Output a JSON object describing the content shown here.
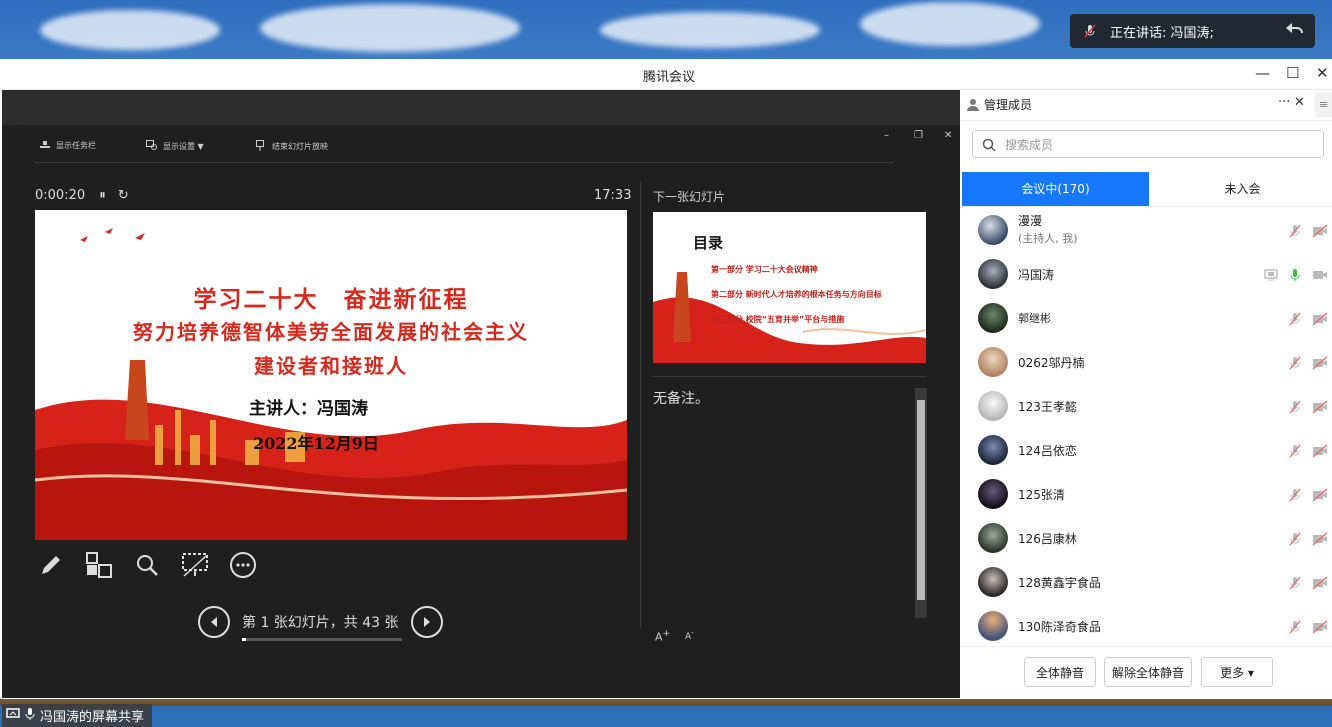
{
  "speaking": {
    "text": "正在讲话: 冯国涛;"
  },
  "window": {
    "title": "腾讯会议"
  },
  "ppt_toolbar": {
    "show_taskbar": "显示任务栏",
    "display_settings": "显示设置 ▼",
    "end_slideshow": "结束幻灯片放映"
  },
  "presenter": {
    "timer": "0:00:20",
    "clock": "17:33",
    "next_label": "下一张幻灯片",
    "notes": "无备注。",
    "slide_nav": "第 1 张幻灯片，共 43 张",
    "progress_fraction": 0.023,
    "font_increase": "A",
    "font_decrease": "A"
  },
  "slide": {
    "line1": "学习二十大　奋进新征程",
    "line2": "努力培养德智体美劳全面发展的社会主义",
    "line3": "建设者和接班人",
    "speaker": "主讲人：冯国涛",
    "date": "2022年12月9日"
  },
  "next_slide": {
    "heading": "目录",
    "items": [
      "第一部分 学习二十大会议精神",
      "第二部分 新时代人才培养的根本任务与方向目标",
      "第三部分 校院“五育并举”平台与措施"
    ]
  },
  "share_label": "冯国涛的屏幕共享",
  "panel": {
    "title": "管理成员",
    "search_placeholder": "搜索成员",
    "tab_in": "会议中(170)",
    "tab_out": "未入会",
    "members": [
      {
        "name": "漫漫",
        "sub": "(主持人, 我)"
      },
      {
        "name": "冯国涛",
        "sub": ""
      },
      {
        "name": "郭继彬",
        "sub": ""
      },
      {
        "name": "0262邬丹楠",
        "sub": ""
      },
      {
        "name": "123王孝懿",
        "sub": ""
      },
      {
        "name": "124吕依恋",
        "sub": ""
      },
      {
        "name": "125张清",
        "sub": ""
      },
      {
        "name": "126吕康林",
        "sub": ""
      },
      {
        "name": "128黄鑫宇食品",
        "sub": ""
      },
      {
        "name": "130陈泽奇食品",
        "sub": ""
      }
    ],
    "mute_all": "全体静音",
    "unmute_all": "解除全体静音",
    "more": "更多 ▾"
  },
  "colors": {
    "accent": "#1677ff",
    "slide_red": "#d6281c",
    "mic_active": "#3cc34a"
  }
}
